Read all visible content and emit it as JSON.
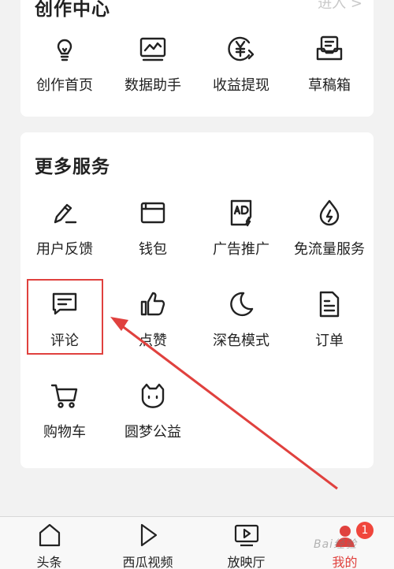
{
  "creation_center": {
    "title": "创作中心",
    "enter": "进入 >",
    "items": [
      {
        "label": "创作首页",
        "icon": "lightbulb-icon"
      },
      {
        "label": "数据助手",
        "icon": "chart-monitor-icon"
      },
      {
        "label": "收益提现",
        "icon": "yen-coin-icon"
      },
      {
        "label": "草稿箱",
        "icon": "draft-box-icon"
      }
    ]
  },
  "more_services": {
    "title": "更多服务",
    "items": [
      {
        "label": "用户反馈",
        "icon": "pen-feedback-icon"
      },
      {
        "label": "钱包",
        "icon": "wallet-icon"
      },
      {
        "label": "广告推广",
        "icon": "ad-promo-icon"
      },
      {
        "label": "免流量服务",
        "icon": "drop-data-icon"
      },
      {
        "label": "评论",
        "icon": "comment-icon"
      },
      {
        "label": "点赞",
        "icon": "thumbs-up-icon"
      },
      {
        "label": "深色模式",
        "icon": "moon-icon"
      },
      {
        "label": "订单",
        "icon": "order-document-icon"
      },
      {
        "label": "购物车",
        "icon": "shopping-cart-icon"
      },
      {
        "label": "圆梦公益",
        "icon": "charity-cat-icon"
      }
    ]
  },
  "tabbar": {
    "tabs": [
      {
        "label": "头条",
        "icon": "home-icon",
        "active": false
      },
      {
        "label": "西瓜视频",
        "icon": "play-icon",
        "active": false
      },
      {
        "label": "放映厅",
        "icon": "video-screen-icon",
        "active": false
      },
      {
        "label": "我的",
        "icon": "profile-icon",
        "active": true
      }
    ],
    "badge_count": "1"
  },
  "annotation": {
    "highlight_color": "#e0413e"
  },
  "watermark": "Bai经验"
}
